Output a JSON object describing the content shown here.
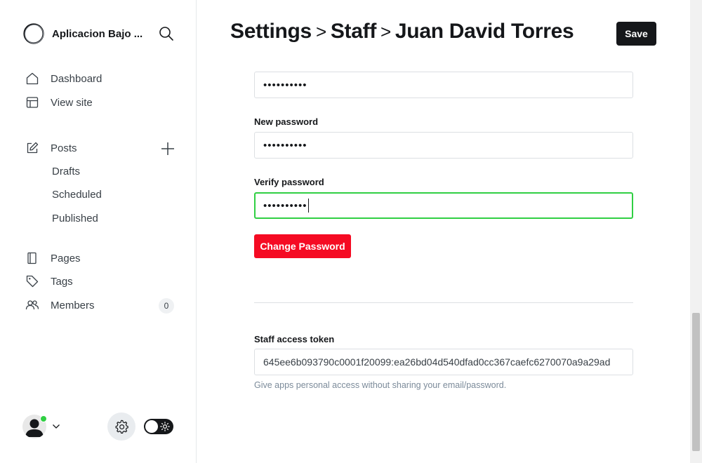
{
  "sidebar": {
    "site_name": "Aplicacion Bajo ...",
    "nav": {
      "dashboard": "Dashboard",
      "view_site": "View site",
      "posts": "Posts",
      "drafts": "Drafts",
      "scheduled": "Scheduled",
      "published": "Published",
      "pages": "Pages",
      "tags": "Tags",
      "members": "Members",
      "members_count": "0"
    }
  },
  "header": {
    "crumb_1": "Settings",
    "crumb_2": "Staff",
    "crumb_3": "Juan David Torres",
    "separator": ">",
    "save_label": "Save"
  },
  "password_form": {
    "old_password_value": "••••••••••",
    "new_password_label": "New password",
    "new_password_value": "••••••••••",
    "verify_password_label": "Verify password",
    "verify_password_value": "••••••••••",
    "change_button": "Change Password"
  },
  "token": {
    "label": "Staff access token",
    "value": "645ee6b093790c0001f20099:ea26bd04d540dfad0cc367caefc6270070a9a29ad",
    "hint": "Give apps personal access without sharing your email/password."
  },
  "colors": {
    "accent_green": "#30cf43",
    "danger_red": "#f50b23",
    "dark": "#15171a"
  },
  "icons": [
    "search-icon",
    "home-icon",
    "view-site-icon",
    "edit-icon",
    "plus-icon",
    "pages-icon",
    "tag-icon",
    "members-icon",
    "chevron-down-icon",
    "gear-icon",
    "sun-icon"
  ]
}
